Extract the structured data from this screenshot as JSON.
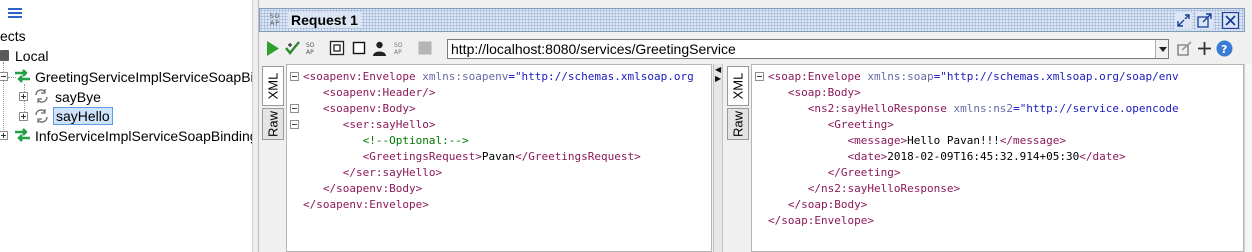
{
  "navigator": {
    "header_partial": "ects",
    "tree": {
      "root_label": "Local",
      "interface_1": "GreetingServiceImplServiceSoapBin",
      "operation_1": "sayBye",
      "operation_2": "sayHello",
      "interface_2": "InfoServiceImplServiceSoapBinding"
    }
  },
  "request": {
    "badge": "SO AP",
    "title": "Request 1",
    "endpoint": "http://localhost:8080/services/GreetingService",
    "tab_xml": "XML",
    "tab_raw": "Raw"
  },
  "request_xml": [
    [
      [
        "t",
        "<soapenv:Envelope "
      ],
      [
        "a",
        "xmlns:soapenv"
      ],
      [
        "p",
        "="
      ],
      [
        "v",
        "\"http://schemas.xmlsoap.org"
      ]
    ],
    [
      [
        "x",
        "   "
      ],
      [
        "t",
        "<soapenv:Header/>"
      ]
    ],
    [
      [
        "x",
        "   "
      ],
      [
        "t",
        "<soapenv:Body>"
      ]
    ],
    [
      [
        "x",
        "      "
      ],
      [
        "t",
        "<ser:sayHello>"
      ]
    ],
    [
      [
        "x",
        "         "
      ],
      [
        "c",
        "<!--Optional:-->"
      ]
    ],
    [
      [
        "x",
        "         "
      ],
      [
        "t",
        "<GreetingsRequest>"
      ],
      [
        "x",
        "Pavan"
      ],
      [
        "t",
        "</GreetingsRequest>"
      ]
    ],
    [
      [
        "x",
        "      "
      ],
      [
        "t",
        "</ser:sayHello>"
      ]
    ],
    [
      [
        "x",
        "   "
      ],
      [
        "t",
        "</soapenv:Body>"
      ]
    ],
    [
      [
        "t",
        "</soapenv:Envelope>"
      ]
    ]
  ],
  "response_xml": [
    [
      [
        "t",
        "<soap:Envelope "
      ],
      [
        "a",
        "xmlns:soap"
      ],
      [
        "p",
        "="
      ],
      [
        "v",
        "\"http://schemas.xmlsoap.org/soap/env"
      ]
    ],
    [
      [
        "x",
        "   "
      ],
      [
        "t",
        "<soap:Body>"
      ]
    ],
    [
      [
        "x",
        "      "
      ],
      [
        "t",
        "<ns2:sayHelloResponse "
      ],
      [
        "a",
        "xmlns:ns2"
      ],
      [
        "p",
        "="
      ],
      [
        "v",
        "\"http://service.opencode"
      ]
    ],
    [
      [
        "x",
        "         "
      ],
      [
        "t",
        "<Greeting>"
      ]
    ],
    [
      [
        "x",
        "            "
      ],
      [
        "t",
        "<message>"
      ],
      [
        "x",
        "Hello Pavan!!!"
      ],
      [
        "t",
        "</message>"
      ]
    ],
    [
      [
        "x",
        "            "
      ],
      [
        "t",
        "<date>"
      ],
      [
        "x",
        "2018-02-09T16:45:32.914+05:30"
      ],
      [
        "t",
        "</date>"
      ]
    ],
    [
      [
        "x",
        "         "
      ],
      [
        "t",
        "</Greeting>"
      ]
    ],
    [
      [
        "x",
        "      "
      ],
      [
        "t",
        "</ns2:sayHelloResponse>"
      ]
    ],
    [
      [
        "x",
        "   "
      ],
      [
        "t",
        "</soap:Body>"
      ]
    ],
    [
      [
        "t",
        "</soap:Envelope>"
      ]
    ]
  ],
  "colors": {
    "run": "#2ea02e",
    "iface": "#23a148",
    "accent": "#2a66c8"
  }
}
